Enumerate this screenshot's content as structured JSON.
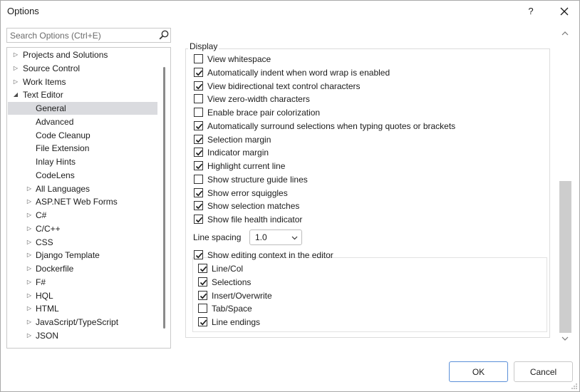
{
  "window": {
    "title": "Options",
    "help_label": "?"
  },
  "search": {
    "placeholder": "Search Options (Ctrl+E)",
    "value": ""
  },
  "tree": [
    {
      "label": "Projects and Solutions",
      "level": 0,
      "expander": "collapsed"
    },
    {
      "label": "Source Control",
      "level": 0,
      "expander": "collapsed"
    },
    {
      "label": "Work Items",
      "level": 0,
      "expander": "collapsed"
    },
    {
      "label": "Text Editor",
      "level": 0,
      "expander": "expanded"
    },
    {
      "label": "General",
      "level": 1,
      "expander": "none",
      "selected": true
    },
    {
      "label": "Advanced",
      "level": 1,
      "expander": "none"
    },
    {
      "label": "Code Cleanup",
      "level": 1,
      "expander": "none"
    },
    {
      "label": "File Extension",
      "level": 1,
      "expander": "none"
    },
    {
      "label": "Inlay Hints",
      "level": 1,
      "expander": "none"
    },
    {
      "label": "CodeLens",
      "level": 1,
      "expander": "none"
    },
    {
      "label": "All Languages",
      "level": 1,
      "expander": "collapsed"
    },
    {
      "label": "ASP.NET Web Forms",
      "level": 1,
      "expander": "collapsed"
    },
    {
      "label": "C#",
      "level": 1,
      "expander": "collapsed"
    },
    {
      "label": "C/C++",
      "level": 1,
      "expander": "collapsed"
    },
    {
      "label": "CSS",
      "level": 1,
      "expander": "collapsed"
    },
    {
      "label": "Django Template",
      "level": 1,
      "expander": "collapsed"
    },
    {
      "label": "Dockerfile",
      "level": 1,
      "expander": "collapsed"
    },
    {
      "label": "F#",
      "level": 1,
      "expander": "collapsed"
    },
    {
      "label": "HQL",
      "level": 1,
      "expander": "collapsed"
    },
    {
      "label": "HTML",
      "level": 1,
      "expander": "collapsed"
    },
    {
      "label": "JavaScript/TypeScript",
      "level": 1,
      "expander": "collapsed"
    },
    {
      "label": "JSON",
      "level": 1,
      "expander": "collapsed"
    }
  ],
  "display": {
    "group_label": "Display",
    "options": [
      {
        "label": "View whitespace",
        "checked": false
      },
      {
        "label": "Automatically indent when word wrap is enabled",
        "checked": true
      },
      {
        "label": "View bidirectional text control characters",
        "checked": true
      },
      {
        "label": "View zero-width characters",
        "checked": false
      },
      {
        "label": "Enable brace pair colorization",
        "checked": false
      },
      {
        "label": "Automatically surround selections when typing quotes or brackets",
        "checked": true
      },
      {
        "label": "Selection margin",
        "checked": true
      },
      {
        "label": "Indicator margin",
        "checked": true
      },
      {
        "label": "Highlight current line",
        "checked": true
      },
      {
        "label": "Show structure guide lines",
        "checked": false
      },
      {
        "label": "Show error squiggles",
        "checked": true
      },
      {
        "label": "Show selection matches",
        "checked": true
      },
      {
        "label": "Show file health indicator",
        "checked": true
      }
    ],
    "line_spacing": {
      "label": "Line spacing",
      "value": "1.0"
    },
    "editing_context": {
      "label": "Show editing context in the editor",
      "checked": true,
      "options": [
        {
          "label": "Line/Col",
          "checked": true
        },
        {
          "label": "Selections",
          "checked": true
        },
        {
          "label": "Insert/Overwrite",
          "checked": true
        },
        {
          "label": "Tab/Space",
          "checked": false
        },
        {
          "label": "Line endings",
          "checked": true
        }
      ]
    }
  },
  "buttons": {
    "ok": "OK",
    "cancel": "Cancel"
  },
  "colors": {
    "selected_bg": "#dadbdf",
    "ok_border": "#5b8fd8",
    "scrollbar_thumb": "#cdcdcd"
  }
}
